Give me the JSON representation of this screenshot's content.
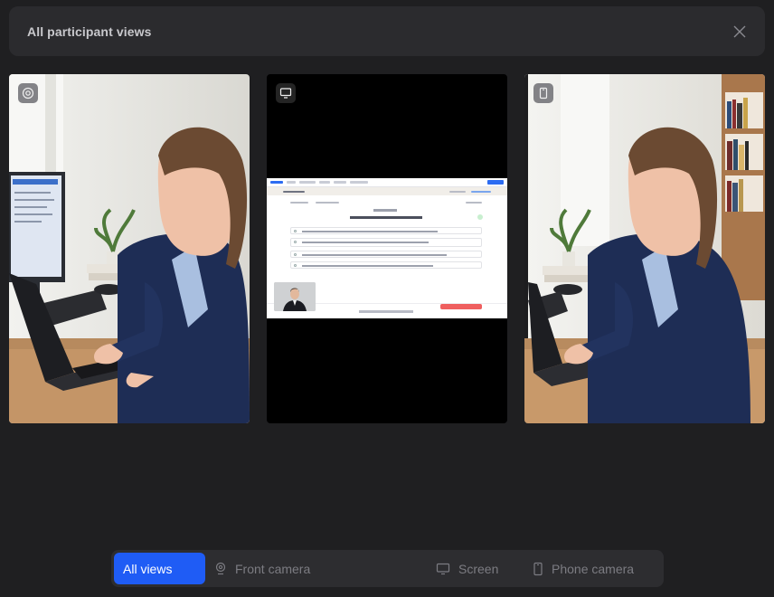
{
  "header": {
    "title": "All participant views"
  },
  "icons": {
    "close": "close-icon",
    "front_camera": "webcam-icon",
    "screen": "monitor-icon",
    "phone": "phone-icon"
  },
  "tabs": [
    {
      "label": "All views",
      "active": true
    },
    {
      "label": "Front camera",
      "active": false
    },
    {
      "label": "Screen",
      "active": false
    },
    {
      "label": "Phone camera",
      "active": false
    }
  ],
  "colors": {
    "accent": "#1f5cf5",
    "background": "#1f1f21",
    "panel": "#2b2b2e"
  }
}
